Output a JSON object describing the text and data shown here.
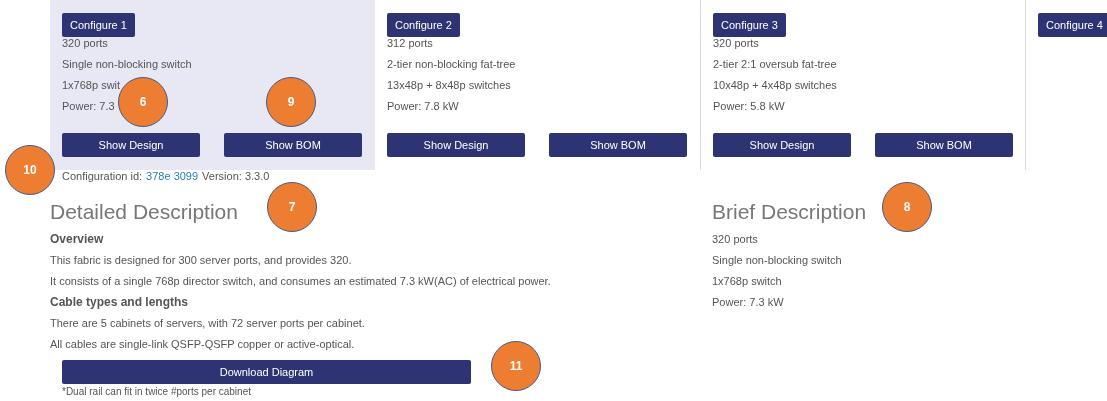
{
  "configurations": [
    {
      "button": "Configure 1",
      "selected": true,
      "lines": [
        "320 ports",
        "Single non-blocking switch",
        "1x768p swit",
        "Power: 7.3"
      ],
      "actions": [
        "Show Design",
        "Show BOM"
      ]
    },
    {
      "button": "Configure 2",
      "selected": false,
      "lines": [
        "312 ports",
        "2-tier non-blocking fat-tree",
        "13x48p + 8x48p switches",
        "Power: 7.8 kW"
      ],
      "actions": [
        "Show Design",
        "Show BOM"
      ]
    },
    {
      "button": "Configure 3",
      "selected": false,
      "lines": [
        "320 ports",
        "2-tier 2:1 oversub fat-tree",
        "10x48p + 4x48p switches",
        "Power: 5.8 kW"
      ],
      "actions": [
        "Show Design",
        "Show BOM"
      ]
    },
    {
      "button": "Configure 4",
      "selected": false
    }
  ],
  "configuration_id": {
    "label": "Configuration id:",
    "id": "378e 3099",
    "version": "Version: 3.3.0"
  },
  "detailed_description": {
    "title": "Detailed Description",
    "sections": [
      {
        "heading": "Overview",
        "paragraphs": [
          "This fabric is designed for 300 server ports, and provides 320.",
          "It consists of a single 768p director switch, and consumes an estimated 7.3 kW(AC) of electrical power."
        ]
      },
      {
        "heading": "Cable types and lengths",
        "paragraphs": [
          "There are 5 cabinets of servers, with 72 server ports per cabinet.",
          "All cables are single-link QSFP-QSFP copper or active-optical."
        ]
      }
    ],
    "button": "Download Diagram",
    "footnote": "*Dual rail can fit in twice #ports per cabinet"
  },
  "brief_description": {
    "title": "Brief Description",
    "lines": [
      "320 ports",
      "Single non-blocking switch",
      "1x768p switch",
      "Power: 7.3 kW"
    ]
  },
  "callouts": [
    {
      "number": "6"
    },
    {
      "number": "9"
    },
    {
      "number": "10"
    },
    {
      "number": "7"
    },
    {
      "number": "8"
    },
    {
      "number": "11"
    }
  ]
}
